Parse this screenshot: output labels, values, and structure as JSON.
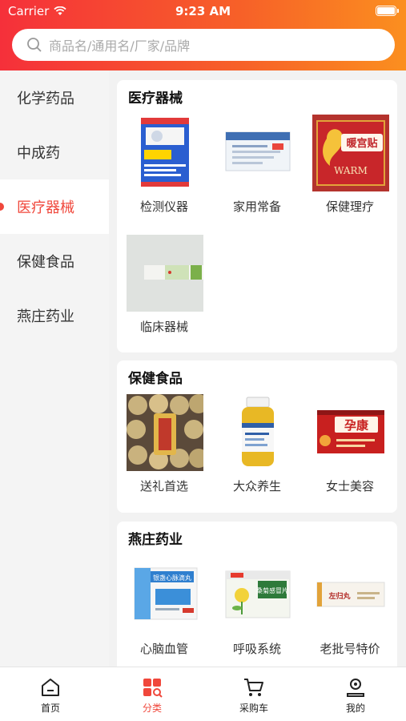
{
  "status": {
    "carrier": "Carrier",
    "time": "9:23 AM"
  },
  "search": {
    "placeholder": "商品名/通用名/厂家/品牌"
  },
  "colors": {
    "accent": "#f0473b",
    "header_start": "#f5303a",
    "header_end": "#fb8f1f"
  },
  "sidebar": {
    "items": [
      {
        "label": "化学药品",
        "active": false
      },
      {
        "label": "中成药",
        "active": false
      },
      {
        "label": "医疗器械",
        "active": true
      },
      {
        "label": "保健食品",
        "active": false
      },
      {
        "label": "燕庄药业",
        "active": false
      }
    ]
  },
  "sections": [
    {
      "title": "医疗器械",
      "items": [
        {
          "label": "检测仪器"
        },
        {
          "label": "家用常备"
        },
        {
          "label": "保健理疗"
        },
        {
          "label": "临床器械"
        }
      ]
    },
    {
      "title": "保健食品",
      "items": [
        {
          "label": "送礼首选"
        },
        {
          "label": "大众养生"
        },
        {
          "label": "女士美容"
        }
      ]
    },
    {
      "title": "燕庄药业",
      "items": [
        {
          "label": "心脑血管"
        },
        {
          "label": "呼吸系统"
        },
        {
          "label": "老批号特价"
        }
      ]
    }
  ],
  "product_text": {
    "p3": "暖宫贴",
    "p3_sub": "WARM",
    "p7": "孕康",
    "p8": "银盏心脉滴丸",
    "p9": "桑菊感冒片",
    "p10": "左归丸"
  },
  "tabbar": {
    "items": [
      {
        "label": "首页",
        "icon": "home-icon",
        "active": false
      },
      {
        "label": "分类",
        "icon": "category-icon",
        "active": true
      },
      {
        "label": "采购车",
        "icon": "cart-icon",
        "active": false
      },
      {
        "label": "我的",
        "icon": "profile-icon",
        "active": false
      }
    ]
  }
}
